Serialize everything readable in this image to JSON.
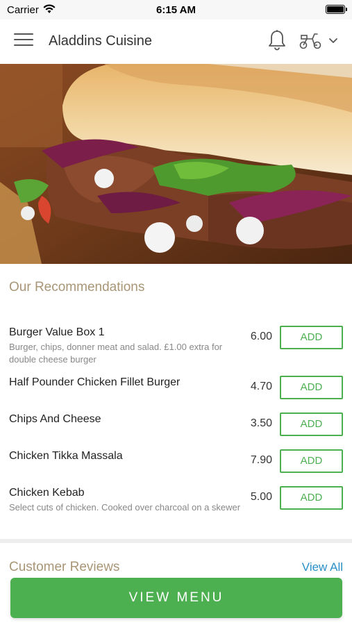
{
  "status_bar": {
    "carrier": "Carrier",
    "time": "6:15 AM",
    "icons": [
      "wifi-icon",
      "battery-icon"
    ]
  },
  "header": {
    "title": "Aladdins Cuisine",
    "icons": [
      "hamburger-menu-icon",
      "bell-icon",
      "scooter-icon",
      "chevron-down-icon"
    ]
  },
  "hero": {
    "image": "kebab-sandwich-photo"
  },
  "recommendations": {
    "title": "Our Recommendations",
    "items": [
      {
        "name": "Burger Value Box 1",
        "description": "Burger, chips, donner meat and salad. £1.00 extra for double cheese burger",
        "price": "6.00",
        "button": "ADD"
      },
      {
        "name": "Half Pounder Chicken Fillet Burger",
        "description": "",
        "price": "4.70",
        "button": "ADD"
      },
      {
        "name": "Chips And Cheese",
        "description": "",
        "price": "3.50",
        "button": "ADD"
      },
      {
        "name": "Chicken Tikka Massala",
        "description": "",
        "price": "7.90",
        "button": "ADD"
      },
      {
        "name": "Chicken Kebab",
        "description": "Select cuts of chicken. Cooked over charcoal on a skewer",
        "price": "5.00",
        "button": "ADD"
      }
    ]
  },
  "reviews": {
    "title": "Customer Reviews",
    "view_all": "View All"
  },
  "footer": {
    "view_menu": "VIEW MENU"
  },
  "colors": {
    "accent_green": "#4caf50",
    "section_title": "#a89676",
    "link_blue": "#2a8fc7"
  }
}
